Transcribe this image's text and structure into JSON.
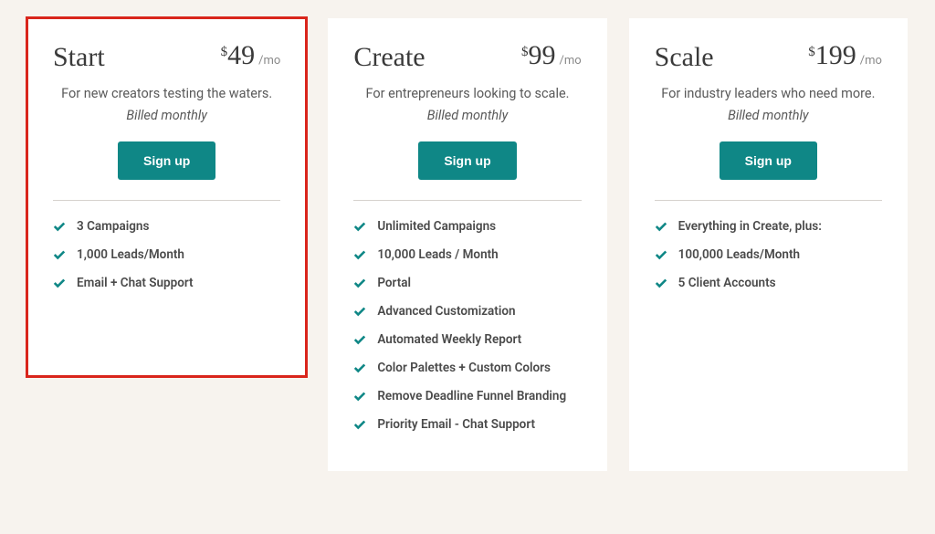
{
  "plans": [
    {
      "name": "Start",
      "currency": "$",
      "price": "49",
      "interval": "/mo",
      "desc": "For new creators testing the waters.",
      "billing": "Billed monthly",
      "cta": "Sign up",
      "highlighted": true,
      "features": [
        "3 Campaigns",
        "1,000 Leads/Month",
        "Email + Chat Support"
      ]
    },
    {
      "name": "Create",
      "currency": "$",
      "price": "99",
      "interval": "/mo",
      "desc": "For entrepreneurs looking to scale.",
      "billing": "Billed monthly",
      "cta": "Sign up",
      "highlighted": false,
      "features": [
        "Unlimited Campaigns",
        "10,000 Leads / Month",
        "Portal",
        "Advanced Customization",
        "Automated Weekly Report",
        "Color Palettes + Custom Colors",
        "Remove Deadline Funnel Branding",
        "Priority Email - Chat Support"
      ]
    },
    {
      "name": "Scale",
      "currency": "$",
      "price": "199",
      "interval": "/mo",
      "desc": "For industry leaders who need more.",
      "billing": "Billed monthly",
      "cta": "Sign up",
      "highlighted": false,
      "features": [
        "Everything in Create, plus:",
        "100,000 Leads/Month",
        "5 Client Accounts"
      ]
    }
  ]
}
